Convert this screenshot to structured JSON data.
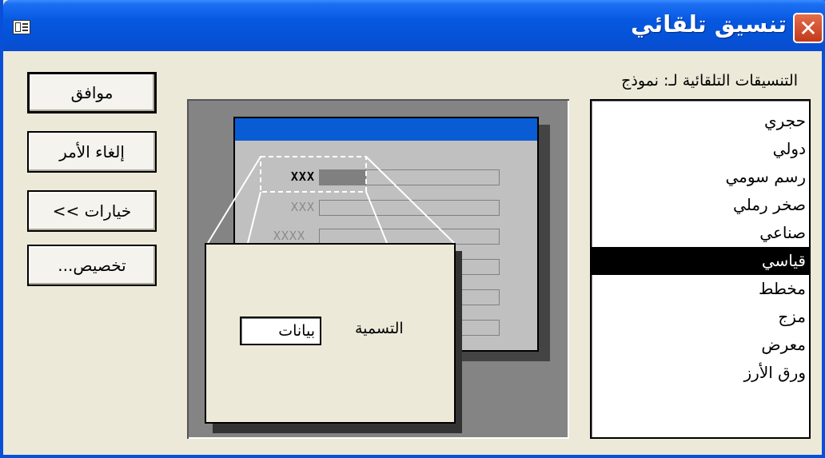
{
  "window": {
    "title": "تنسيق تلقائي",
    "close_glyph": "✕"
  },
  "buttons": {
    "ok": "موافق",
    "cancel": "إلغاء الأمر",
    "options": "خيارات >>",
    "customize": "تخصيص..."
  },
  "list": {
    "caption": "التنسيقات التلقائية لـ: نموذج",
    "items": [
      "حجري",
      "دولي",
      "رسم سومي",
      "صخر رملي",
      "صناعي",
      "قياسي",
      "مخطط",
      "مزج",
      "معرض",
      "ورق الأرز"
    ],
    "selected_index": 5
  },
  "preview": {
    "field_labels": [
      "XXX",
      "XXX",
      "XXXX"
    ],
    "zoom_label": "التسمية",
    "zoom_value": "بيانات"
  },
  "colors": {
    "title_bar": "#0453d8",
    "form_title": "#0a5cd5",
    "selection": "#000000"
  }
}
